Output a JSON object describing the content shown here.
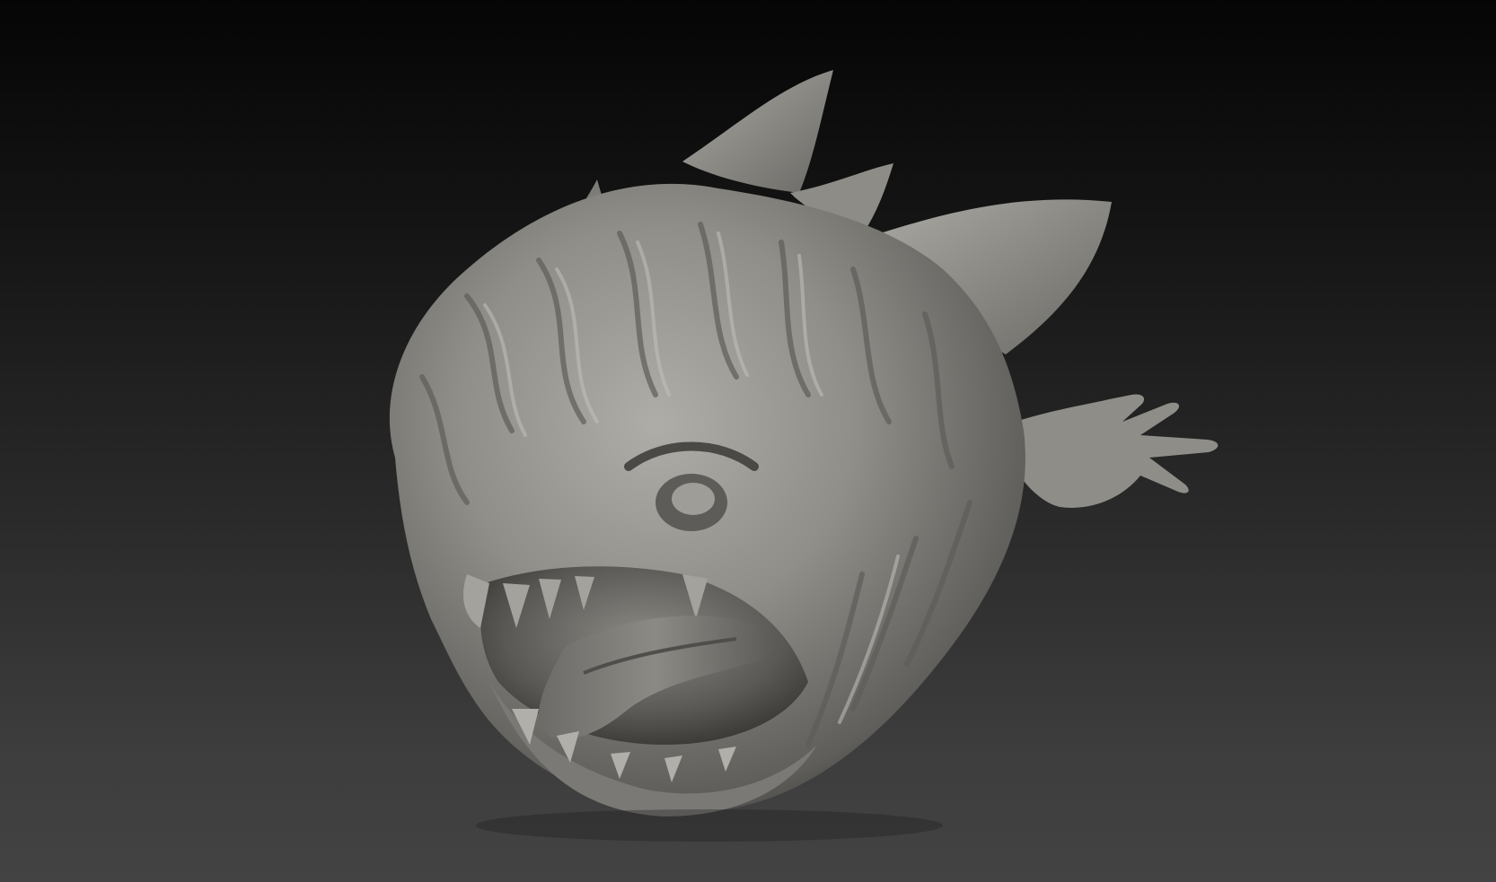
{
  "scene": {
    "subject": "ghost-creature-sculpt",
    "colors": {
      "background_top": "#050505",
      "background_bottom": "#434343",
      "clay_base": "#8a8985",
      "clay_highlight": "#b4b3ad",
      "clay_shadow": "#3e3d3a",
      "mouth_interior": "#2a2927"
    }
  }
}
